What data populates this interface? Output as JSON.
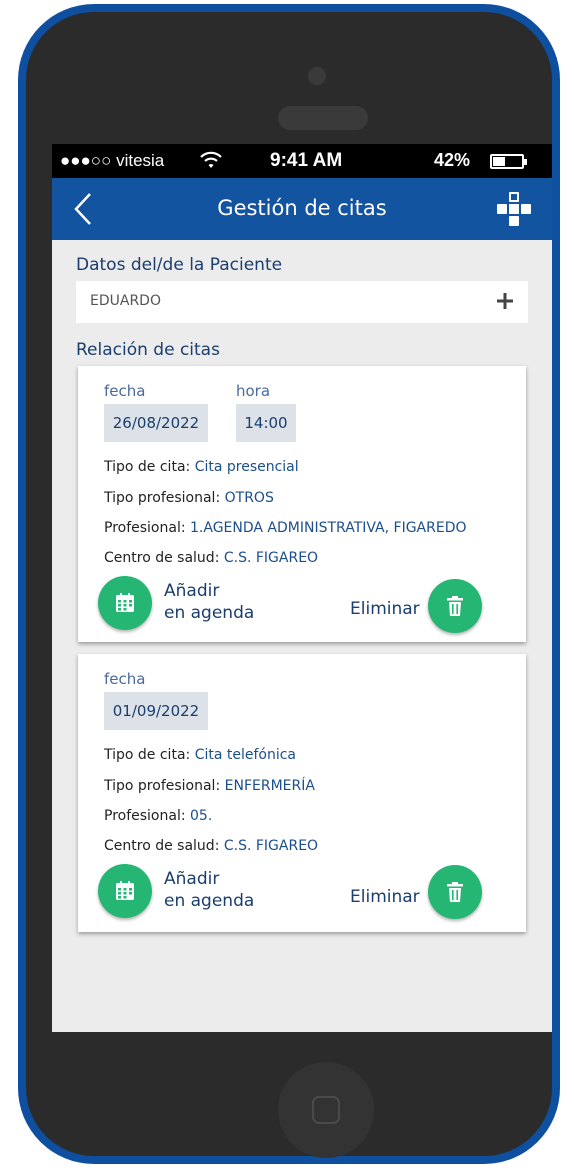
{
  "status_bar": {
    "carrier": "●●●○○ vitesia",
    "time": "9:41 AM",
    "battery": "42%",
    "battery_level": 0.42
  },
  "header": {
    "title": "Gestión de citas"
  },
  "patient": {
    "section_label": "Datos del/de la Paciente",
    "name": "EDUARDO"
  },
  "appointments": {
    "section_label": "Relación de citas",
    "items": [
      {
        "date_label": "fecha",
        "date": "26/08/2022",
        "time_label": "hora",
        "time": "14:00",
        "type_label": "Tipo de cita: ",
        "type": "Cita presencial",
        "prof_type_label": "Tipo profesional: ",
        "prof_type": "OTROS",
        "prof_label": "Profesional: ",
        "prof": "1.AGENDA ADMINISTRATIVA, FIGAREDO",
        "center_label": "Centro de salud: ",
        "center": "C.S. FIGAREO",
        "add_line1": "Añadir",
        "add_line2": "en agenda",
        "delete": "Eliminar"
      },
      {
        "date_label": "fecha",
        "date": "01/09/2022",
        "type_label": "Tipo de cita: ",
        "type": "Cita telefónica",
        "prof_type_label": "Tipo profesional: ",
        "prof_type": "ENFERMERÍA",
        "prof_label": "Profesional: ",
        "prof": "05.",
        "center_label": "Centro de salud: ",
        "center": "C.S. FIGAREO",
        "add_line1": "Añadir",
        "add_line2": "en agenda",
        "delete": "Eliminar"
      }
    ]
  },
  "colors": {
    "primary": "#1254a0",
    "accent_green": "#26b673",
    "background": "#ececec"
  },
  "icons": [
    "back-chevron-icon",
    "app-logo-icon",
    "plus-icon",
    "calendar-icon",
    "trash-icon",
    "wifi-icon",
    "battery-icon"
  ]
}
